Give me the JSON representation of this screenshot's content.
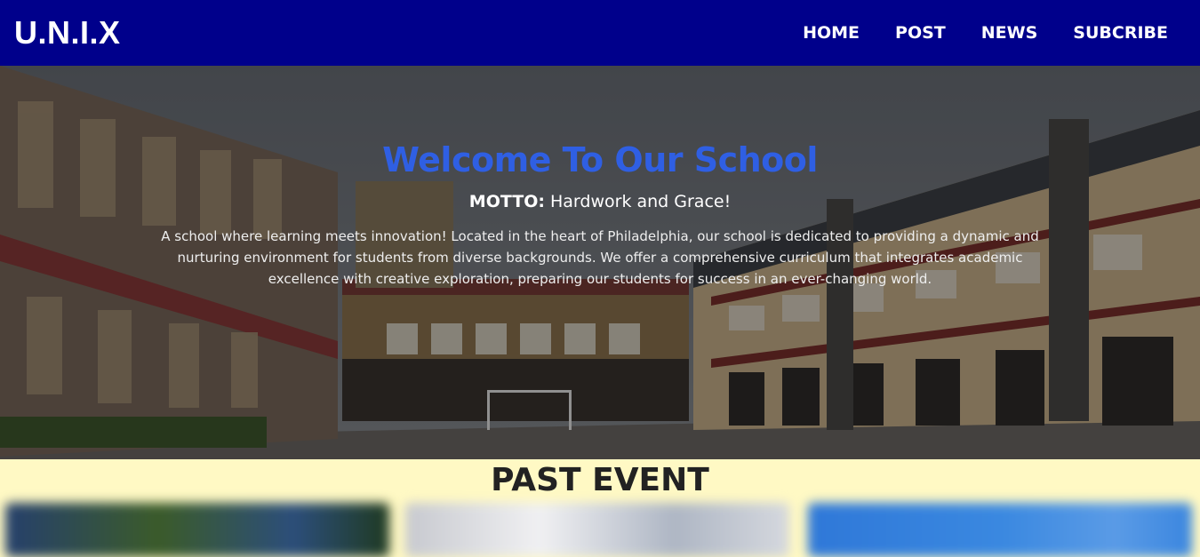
{
  "navbar": {
    "brand": "U.N.I.X",
    "links": [
      {
        "label": "HOME"
      },
      {
        "label": "POST"
      },
      {
        "label": "NEWS"
      },
      {
        "label": "SUBCRIBE"
      }
    ]
  },
  "hero": {
    "title": "Welcome To Our School",
    "motto_label": "MOTTO:",
    "motto_text": "Hardwork and Grace!",
    "description": "A school where learning meets innovation! Located in the heart of Philadelphia, our school is dedicated to providing a dynamic and nurturing environment for students from diverse backgrounds. We offer a comprehensive curriculum that integrates academic excellence with creative exploration, preparing our students for success in an ever-changing world.",
    "title_color": "#2f5fe3"
  },
  "past_event": {
    "title": "PAST EVENT"
  },
  "colors": {
    "navbar": "#00008b",
    "section_bg": "#fff9c4"
  }
}
